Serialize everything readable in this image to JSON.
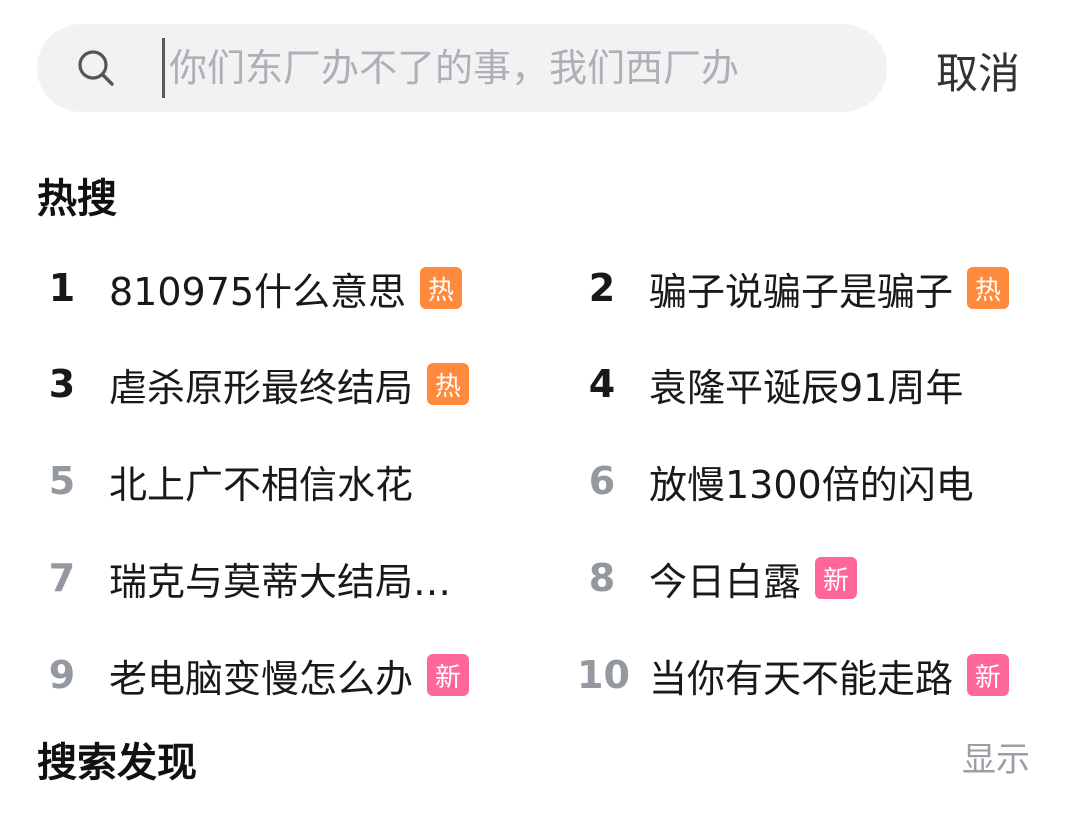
{
  "search": {
    "placeholder": "你们东厂办不了的事，我们西厂办",
    "cancel_label": "取消"
  },
  "hot_search": {
    "title": "热搜",
    "items": [
      {
        "rank": "1",
        "title": "810975什么意思",
        "badge": "热"
      },
      {
        "rank": "2",
        "title": "骗子说骗子是骗子",
        "badge": "热"
      },
      {
        "rank": "3",
        "title": "虐杀原形最终结局",
        "badge": "热"
      },
      {
        "rank": "4",
        "title": "袁隆平诞辰91周年",
        "badge": ""
      },
      {
        "rank": "5",
        "title": "北上广不相信水花",
        "badge": ""
      },
      {
        "rank": "6",
        "title": "放慢1300倍的闪电",
        "badge": ""
      },
      {
        "rank": "7",
        "title": "瑞克与莫蒂大结局…",
        "badge": ""
      },
      {
        "rank": "8",
        "title": "今日白露",
        "badge": "新"
      },
      {
        "rank": "9",
        "title": "老电脑变慢怎么办",
        "badge": "新"
      },
      {
        "rank": "10",
        "title": "当你有天不能走路",
        "badge": "新"
      }
    ]
  },
  "discover": {
    "title": "搜索发现",
    "toggle_label": "显示"
  },
  "colors": {
    "hot_badge": "#ff8a3d",
    "new_badge": "#ff6699",
    "rank_top": "#18191c",
    "rank_normal": "#9499a0"
  }
}
